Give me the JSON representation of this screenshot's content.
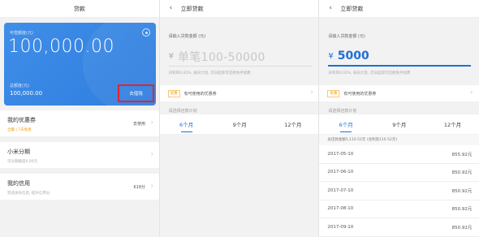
{
  "loan_home": {
    "title": "贷款",
    "card": {
      "available_label": "可借额度(元)",
      "available_amount": "100,000.00",
      "total_label": "总额度(元)",
      "total_amount": "100,000.00",
      "withdraw_label": "去借钱",
      "accent": "#2f7ddf",
      "highlight_color": "#e2242d"
    },
    "items": [
      {
        "title": "我的优惠券",
        "sub": "全额 | 7天免息",
        "right": "去使用"
      },
      {
        "title": "小米分期",
        "sub": "可分期额度0.00元",
        "right": ""
      },
      {
        "title": "我的信用",
        "sub": "完成身份信息, 提升信用分",
        "right": "618分"
      }
    ]
  },
  "borrow_empty": {
    "title": "立即贷款",
    "input_label": "请输入贷款金额 (元)",
    "currency": "¥",
    "placeholder": "单笔100-50000",
    "note": "日利率0.02%, 按日计息, 次日起即可还款免手续费",
    "coupon_tag": "优惠",
    "coupon_text": "有可使用的优惠券",
    "plan_label": "请选择还款计划",
    "tabs": [
      "6个月",
      "9个月",
      "12个月"
    ],
    "active_tab": 0
  },
  "borrow_filled": {
    "title": "立即贷款",
    "input_label": "请输入贷款金额 (元)",
    "currency": "¥",
    "value": "5000",
    "note": "日利率0.02%, 按日计息, 次日起即可还款免手续费",
    "coupon_tag": "优惠",
    "coupon_text": "有可使用的优惠券",
    "plan_label": "请选择还款计划",
    "tabs": [
      "6个月",
      "9个月",
      "12个月"
    ],
    "active_tab": 0,
    "total": "总还款金额5,110.52元 (含利息110.52元)",
    "schedule": [
      {
        "date": "2017-05-10",
        "amount": "855.92元"
      },
      {
        "date": "2017-06-10",
        "amount": "850.92元"
      },
      {
        "date": "2017-07-10",
        "amount": "850.92元"
      },
      {
        "date": "2017-08-10",
        "amount": "850.92元"
      },
      {
        "date": "2017-09-10",
        "amount": "850.92元"
      }
    ]
  }
}
